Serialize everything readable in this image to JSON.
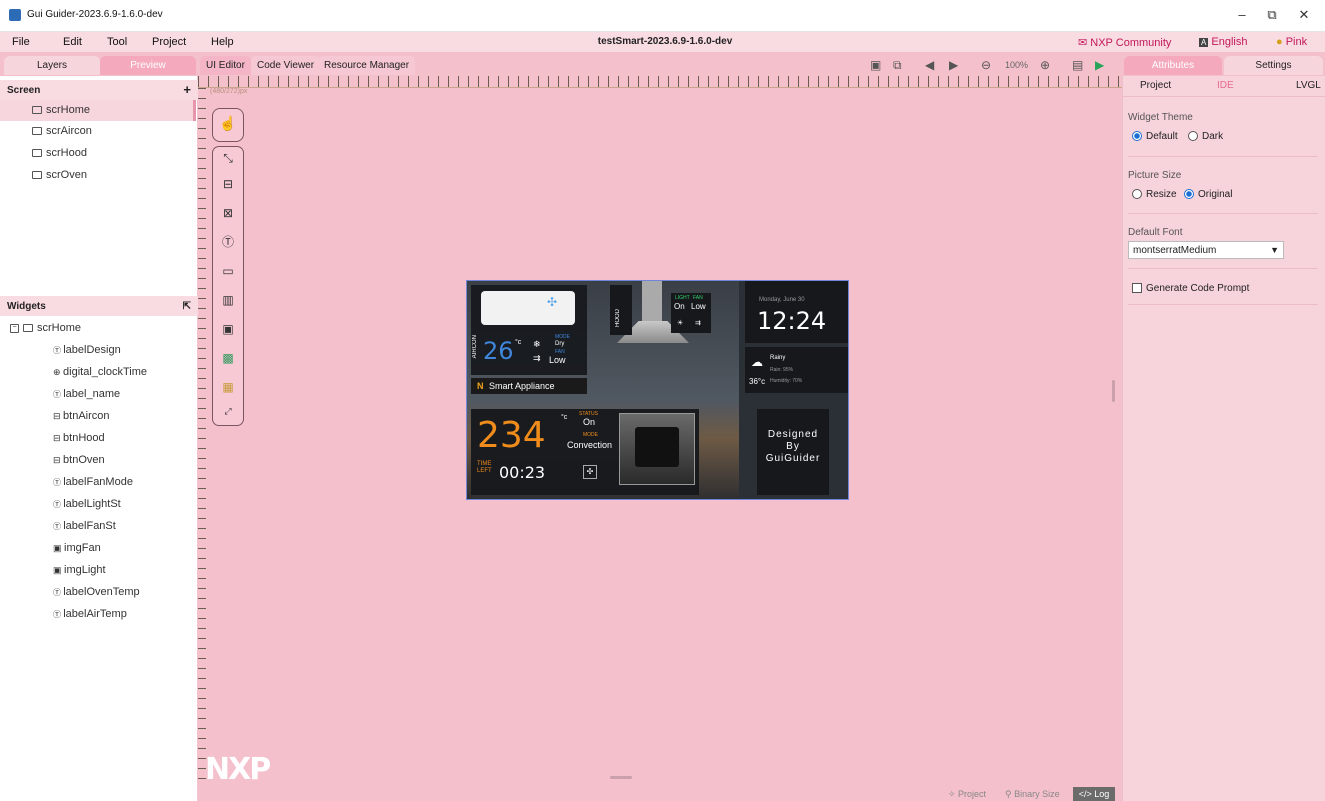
{
  "window": {
    "title": "Gui Guider-2023.6.9-1.6.0-dev",
    "document_title": "testSmart-2023.6.9-1.6.0-dev"
  },
  "menu": [
    "File",
    "Edit",
    "Tool",
    "Project",
    "Help"
  ],
  "header_links": {
    "community": "NXP Community",
    "language": "English",
    "theme": "Pink"
  },
  "left_tabs": [
    "Layers",
    "Preview"
  ],
  "center_tabs": [
    "UI Editor",
    "Code Viewer",
    "Resource Manager"
  ],
  "toolbar": {
    "zoom": "100%"
  },
  "screens": {
    "title": "Screen",
    "add": "+",
    "items": [
      "scrHome",
      "scrAircon",
      "scrHood",
      "scrOven"
    ]
  },
  "widgets": {
    "title": "Widgets",
    "root": "scrHome",
    "items": [
      "labelDesign",
      "digital_clockTime",
      "label_name",
      "btnAircon",
      "btnHood",
      "btnOven",
      "labelFanMode",
      "labelLightSt",
      "labelFanSt",
      "imgFan",
      "imgLight",
      "labelOvenTemp",
      "labelAirTemp"
    ]
  },
  "canvas": {
    "size_label": "(480/272)px",
    "logo": "NXP"
  },
  "status_bar": {
    "project": "Project",
    "binary_size": "Binary Size",
    "log": "</> Log"
  },
  "right_tabs": [
    "Attributes",
    "Settings"
  ],
  "right_subtabs": [
    "Project",
    "IDE",
    "LVGL"
  ],
  "settings": {
    "widget_theme_label": "Widget Theme",
    "theme_default": "Default",
    "theme_dark": "Dark",
    "picture_size_label": "Picture Size",
    "size_resize": "Resize",
    "size_original": "Original",
    "default_font_label": "Default Font",
    "default_font_value": "montserratMedium",
    "generate_prompt": "Generate Code Prompt"
  },
  "device_screen": {
    "aircon_label": "AIRCON",
    "air_temp": "26",
    "air_unit": "°c",
    "air_mode_title": "MODE",
    "air_mode": "Dry",
    "air_fan_title": "FAN",
    "air_fan": "Low",
    "hood_label": "HOOD",
    "light_title": "LIGHT",
    "fan_title": "FAN",
    "light_state": "On",
    "fan_state": "Low",
    "brand": "Smart Appliance",
    "oven_temp": "234",
    "oven_unit": "°c",
    "status_title": "STATUS",
    "status": "On",
    "mode_title": "MODE",
    "mode": "Convection",
    "time_left_label": "TIME LEFT",
    "time_left": "00:23",
    "date": "Monday, June 30",
    "clock": "12:24",
    "weather": "Rainy",
    "rain": "Rain: 95%",
    "outdoor_temp": "36°c",
    "humidity": "Humidity: 70%",
    "designed": "Designed",
    "by": "By",
    "guider": "GuiGuider"
  }
}
